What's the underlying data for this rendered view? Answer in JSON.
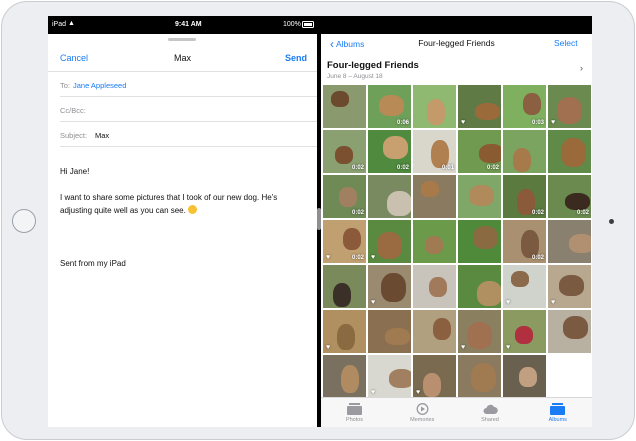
{
  "status_bar": {
    "carrier": "iPad",
    "time": "9:41 AM",
    "battery": "100%"
  },
  "mail": {
    "cancel_label": "Cancel",
    "title": "Max",
    "send_label": "Send",
    "to_label": "To:",
    "to_value": "Jane Appleseed",
    "cc_label": "Cc/Bcc:",
    "subject_label": "Subject:",
    "subject_value": "Max",
    "greeting": "Hi Jane!",
    "body": "I want to share some pictures that I took of our new dog. He's adjusting quite well as you can see.",
    "emoji_icon": "smiley-emoji-icon",
    "signature": "Sent from my iPad"
  },
  "photos": {
    "back_label": "Albums",
    "title": "Four-legged Friends",
    "select_label": "Select",
    "album_title": "Four-legged Friends",
    "album_dates": "June 8 – August 18",
    "grid": [
      {
        "bg": "#8a9a6e",
        "fg": "#6b4a2e",
        "dur": "",
        "fav": false
      },
      {
        "bg": "#6fa05a",
        "fg": "#b88a55",
        "dur": "0:06",
        "fav": false
      },
      {
        "bg": "#8fb870",
        "fg": "#c49a6a",
        "dur": "",
        "fav": false
      },
      {
        "bg": "#5f7a45",
        "fg": "#9a6a3a",
        "dur": "",
        "fav": true
      },
      {
        "bg": "#7fb060",
        "fg": "#8a6040",
        "dur": "0:03",
        "fav": false
      },
      {
        "bg": "#6a8a50",
        "fg": "#a07050",
        "dur": "",
        "fav": true
      },
      {
        "bg": "#8aa070",
        "fg": "#7a5030",
        "dur": "0:02",
        "fav": false
      },
      {
        "bg": "#4f8a3e",
        "fg": "#c8a070",
        "dur": "0:02",
        "fav": false
      },
      {
        "bg": "#d9d6cc",
        "fg": "#b08050",
        "dur": "0:01",
        "fav": false
      },
      {
        "bg": "#6f9a50",
        "fg": "#8a5a30",
        "dur": "0:02",
        "fav": false
      },
      {
        "bg": "#7aa460",
        "fg": "#a67a4a",
        "dur": "",
        "fav": false
      },
      {
        "bg": "#5f8a48",
        "fg": "#9a6a3a",
        "dur": "",
        "fav": false
      },
      {
        "bg": "#6f8a55",
        "fg": "#a08060",
        "dur": "0:02",
        "fav": false
      },
      {
        "bg": "#7a8a60",
        "fg": "#c9c0b0",
        "dur": "",
        "fav": false
      },
      {
        "bg": "#8a7a60",
        "fg": "#a87a4a",
        "dur": "",
        "fav": false
      },
      {
        "bg": "#7fa868",
        "fg": "#b08a5a",
        "dur": "",
        "fav": false
      },
      {
        "bg": "#5a7a40",
        "fg": "#8a5a3a",
        "dur": "0:02",
        "fav": false
      },
      {
        "bg": "#6a8a50",
        "fg": "#3a2a20",
        "dur": "0:02",
        "fav": false
      },
      {
        "bg": "#c0a070",
        "fg": "#8a5a3a",
        "dur": "0:02",
        "fav": true
      },
      {
        "bg": "#5a8a40",
        "fg": "#9a6a40",
        "dur": "",
        "fav": true
      },
      {
        "bg": "#6a9a4a",
        "fg": "#a07a50",
        "dur": "",
        "fav": false
      },
      {
        "bg": "#4f8a3a",
        "fg": "#8a6a40",
        "dur": "",
        "fav": false
      },
      {
        "bg": "#a89070",
        "fg": "#7a5a40",
        "dur": "0:02",
        "fav": false
      },
      {
        "bg": "#8a8070",
        "fg": "#b09070",
        "dur": "",
        "fav": false
      },
      {
        "bg": "#7a8a5a",
        "fg": "#3a3028",
        "dur": "",
        "fav": false
      },
      {
        "bg": "#9a8a70",
        "fg": "#6a4a30",
        "dur": "",
        "fav": true
      },
      {
        "bg": "#c8c4bc",
        "fg": "#a07a5a",
        "dur": "",
        "fav": false
      },
      {
        "bg": "#5a8a40",
        "fg": "#b09060",
        "dur": "",
        "fav": false
      },
      {
        "bg": "#d0d2cc",
        "fg": "#8a6a4a",
        "dur": "",
        "fav": true
      },
      {
        "bg": "#b8a890",
        "fg": "#7a5a40",
        "dur": "",
        "fav": true
      },
      {
        "bg": "#b09060",
        "fg": "#8a6a40",
        "dur": "",
        "fav": true
      },
      {
        "bg": "#8a7050",
        "fg": "#a07a50",
        "dur": "",
        "fav": false
      },
      {
        "bg": "#b0a080",
        "fg": "#8a6040",
        "dur": "",
        "fav": false
      },
      {
        "bg": "#8a8060",
        "fg": "#a07050",
        "dur": "",
        "fav": true
      },
      {
        "bg": "#8a9a60",
        "fg": "#b03040",
        "dur": "",
        "fav": true
      },
      {
        "bg": "#b8b0a0",
        "fg": "#7a5a40",
        "dur": "",
        "fav": false
      },
      {
        "bg": "#7a7060",
        "fg": "#b08a60",
        "dur": "",
        "fav": false
      },
      {
        "bg": "#d8d8d0",
        "fg": "#a08060",
        "dur": "",
        "fav": true
      },
      {
        "bg": "#7a6a50",
        "fg": "#b89070",
        "dur": "",
        "fav": true
      },
      {
        "bg": "#8a7a60",
        "fg": "#a07a50",
        "dur": "",
        "fav": false
      },
      {
        "bg": "#6a6050",
        "fg": "#c0a080",
        "dur": "",
        "fav": false
      }
    ],
    "tabs": [
      {
        "label": "Photos",
        "icon": "photos-stack-icon",
        "active": false
      },
      {
        "label": "Memories",
        "icon": "memories-play-icon",
        "active": false
      },
      {
        "label": "Shared",
        "icon": "shared-cloud-icon",
        "active": false
      },
      {
        "label": "Albums",
        "icon": "albums-folder-icon",
        "active": true
      }
    ]
  },
  "colors": {
    "accent": "#1a7cf5",
    "inactive": "#8e8e93"
  }
}
